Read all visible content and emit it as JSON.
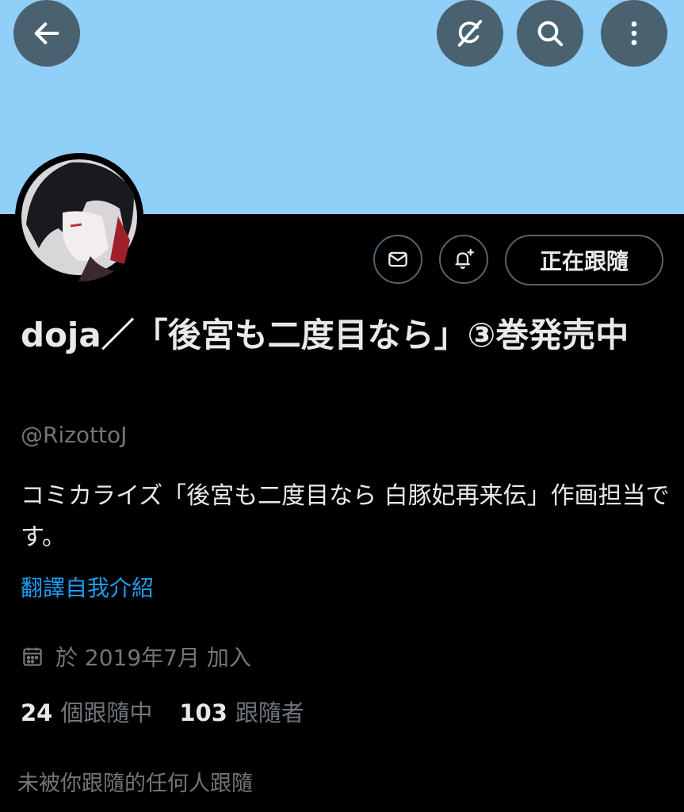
{
  "header": {
    "back_icon": "arrow-left-icon",
    "grok_icon": "grok-icon",
    "search_icon": "search-icon",
    "more_icon": "more-vertical-icon",
    "banner_color": "#8fcff8"
  },
  "profile": {
    "display_name": "doja／「後宮も二度目なら」③巻発売中",
    "handle": "@RizottoJ",
    "bio": "コミカライズ「後宮も二度目なら 白豚妃再来伝」作画担当です。",
    "translate_label": "翻譯自我介紹",
    "joined": "於 2019年7月 加入",
    "following_count": "24",
    "following_label": "個跟隨中",
    "followers_count": "103",
    "followers_label": "跟隨者",
    "not_followed_text": "未被你跟隨的任何人跟隨"
  },
  "actions": {
    "message_icon": "mail-icon",
    "notify_icon": "bell-plus-icon",
    "follow_label": "正在跟隨"
  },
  "colors": {
    "accent": "#1d9bf0",
    "secondary_text": "#71767b",
    "primary_text": "#e7e9ea"
  }
}
